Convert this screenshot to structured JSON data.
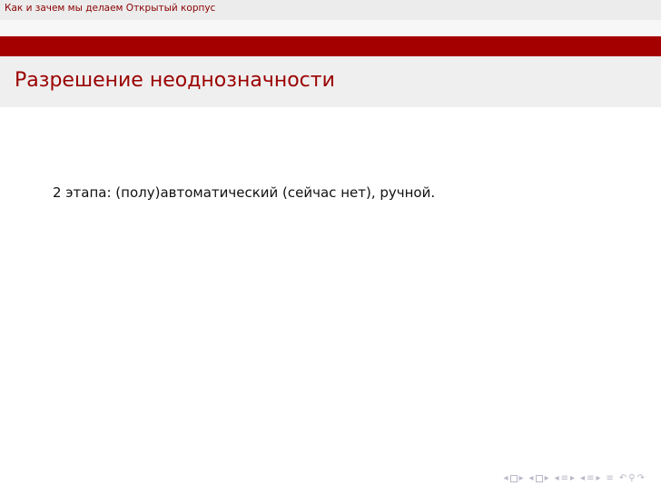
{
  "header": {
    "title": "Как и зачем мы делаем Открытый корпус"
  },
  "frame": {
    "title": "Разрешение неоднозначности",
    "body": "2 этапа: (полу)автоматический (сейчас нет), ручной."
  },
  "colors": {
    "accent_red": "#a40000",
    "title_red": "#9b0000",
    "nav_icon_gray": "#b8b8c8"
  }
}
